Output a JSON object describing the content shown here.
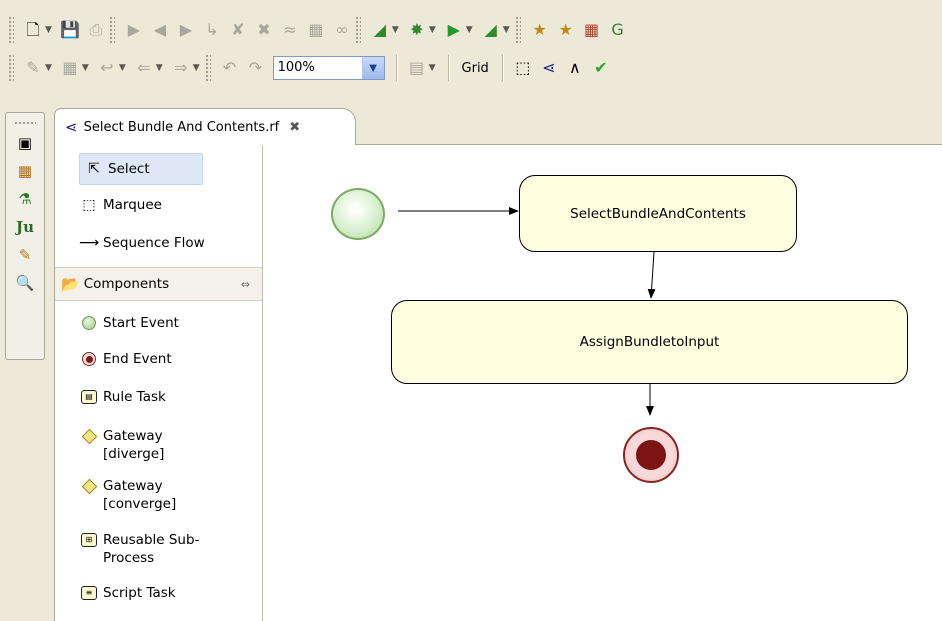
{
  "toolbar": {
    "zoom_value": "100%",
    "grid_label": "Grid"
  },
  "editor": {
    "tab_label": "Select Bundle And Contents.rf"
  },
  "palette": {
    "tools": [
      {
        "label": "Select"
      },
      {
        "label": "Marquee"
      },
      {
        "label": "Sequence Flow"
      }
    ],
    "drawer_label": "Components",
    "components": [
      {
        "label": "Start Event"
      },
      {
        "label": "End Event"
      },
      {
        "label": "Rule Task"
      },
      {
        "label": "Gateway\n[diverge]"
      },
      {
        "label": "Gateway\n[converge]"
      },
      {
        "label": "Reusable Sub-\nProcess"
      },
      {
        "label": "Script Task"
      }
    ]
  },
  "diagram": {
    "nodes": [
      {
        "label": "SelectBundleAndContents"
      },
      {
        "label": "AssignBundletoInput"
      }
    ]
  }
}
